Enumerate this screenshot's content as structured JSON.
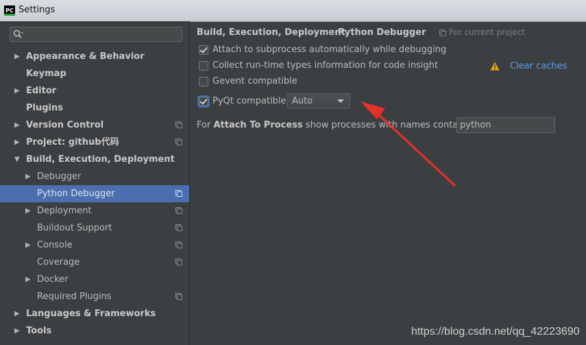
{
  "window": {
    "title": "Settings",
    "app_icon": "PC"
  },
  "search": {
    "value": "",
    "icon": "search-icon"
  },
  "tree": [
    {
      "label": "Appearance & Behavior",
      "bold": true,
      "expandable": true,
      "expanded": false,
      "depth": 0,
      "project_scope": false
    },
    {
      "label": "Keymap",
      "bold": true,
      "expandable": false,
      "depth": 0,
      "project_scope": false
    },
    {
      "label": "Editor",
      "bold": true,
      "expandable": true,
      "expanded": false,
      "depth": 0,
      "project_scope": false
    },
    {
      "label": "Plugins",
      "bold": true,
      "expandable": false,
      "depth": 0,
      "project_scope": false
    },
    {
      "label": "Version Control",
      "bold": true,
      "expandable": true,
      "expanded": false,
      "depth": 0,
      "project_scope": true
    },
    {
      "label": "Project: github代码",
      "bold": true,
      "expandable": true,
      "expanded": false,
      "depth": 0,
      "project_scope": true
    },
    {
      "label": "Build, Execution, Deployment",
      "bold": true,
      "expandable": true,
      "expanded": true,
      "depth": 0,
      "project_scope": false
    },
    {
      "label": "Debugger",
      "bold": false,
      "expandable": true,
      "expanded": false,
      "depth": 1,
      "project_scope": false
    },
    {
      "label": "Python Debugger",
      "bold": false,
      "expandable": false,
      "depth": 1,
      "project_scope": true,
      "selected": true
    },
    {
      "label": "Deployment",
      "bold": false,
      "expandable": true,
      "expanded": false,
      "depth": 1,
      "project_scope": true
    },
    {
      "label": "Buildout Support",
      "bold": false,
      "expandable": false,
      "depth": 1,
      "project_scope": true
    },
    {
      "label": "Console",
      "bold": false,
      "expandable": true,
      "expanded": false,
      "depth": 1,
      "project_scope": true
    },
    {
      "label": "Coverage",
      "bold": false,
      "expandable": false,
      "depth": 1,
      "project_scope": true
    },
    {
      "label": "Docker",
      "bold": false,
      "expandable": true,
      "expanded": false,
      "depth": 1,
      "project_scope": false
    },
    {
      "label": "Required Plugins",
      "bold": false,
      "expandable": false,
      "depth": 1,
      "project_scope": true
    },
    {
      "label": "Languages & Frameworks",
      "bold": true,
      "expandable": true,
      "expanded": false,
      "depth": 0,
      "project_scope": false
    },
    {
      "label": "Tools",
      "bold": true,
      "expandable": true,
      "expanded": false,
      "depth": 0,
      "project_scope": false
    }
  ],
  "breadcrumb": {
    "parent": "Build, Execution, Deployment",
    "separator": "›",
    "current": "Python Debugger",
    "scope_label": "For current project"
  },
  "options": {
    "attach_subprocess": {
      "label": "Attach to subprocess automatically while debugging",
      "checked": true
    },
    "collect_types": {
      "label": "Collect run-time types information for code insight",
      "checked": false
    },
    "gevent": {
      "label": "Gevent compatible",
      "checked": false
    },
    "pyqt": {
      "label": "PyQt compatible",
      "checked": true,
      "focused": true,
      "selected_option": "Auto"
    }
  },
  "clear_caches": {
    "label": "Clear caches",
    "icon": "warning-icon"
  },
  "attach_process": {
    "prefix": "For ",
    "bold": "Attach To Process",
    "suffix": " show processes with names containing:",
    "value": "python"
  },
  "watermark": "https://blog.csdn.net/qq_42223690",
  "colors": {
    "selection": "#4b6eaf",
    "link": "#589df6",
    "warning": "#f0a30a",
    "annotation_arrow": "#e8302a"
  }
}
